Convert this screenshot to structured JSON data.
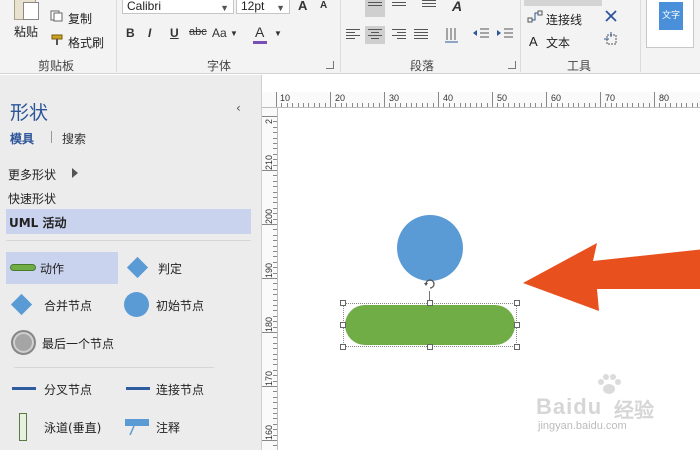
{
  "ribbon": {
    "clipboard": {
      "paste": "粘贴",
      "copy": "复制",
      "format_painter": "格式刷",
      "group": "剪贴板"
    },
    "font": {
      "name": "Calibri",
      "size": "12pt",
      "grow": "A",
      "shrink": "A",
      "bold": "B",
      "italic": "I",
      "underline": "U",
      "strike": "abc",
      "case": "Aa",
      "color_letter": "A",
      "group": "字体"
    },
    "paragraph": {
      "group": "段落",
      "text_glyph": "A"
    },
    "tools": {
      "connector": "连接线",
      "text": "文本",
      "text_letter": "A",
      "group": "工具"
    },
    "text_style": {
      "label": "文字"
    }
  },
  "shapes_pane": {
    "title": "形状",
    "collapse": "‹",
    "tabs": {
      "models": "模具",
      "search": "搜索"
    },
    "more_shapes": "更多形状",
    "quick_shapes": "快速形状",
    "stencil_title": "UML 活动",
    "stencils": {
      "action": "动作",
      "decision": "判定",
      "merge": "合并节点",
      "initial": "初始节点",
      "final": "最后一个节点",
      "fork": "分叉节点",
      "join": "连接节点",
      "swimlane": "泳道(垂直)",
      "note": "注释"
    }
  },
  "ruler": {
    "h_ticks": [
      "10",
      "20",
      "30",
      "40",
      "50",
      "60",
      "70",
      "80"
    ],
    "v_ticks": [
      "210",
      "200",
      "190",
      "180",
      "170",
      "160",
      "2"
    ]
  },
  "colors": {
    "accent": "#2d5599",
    "initial_node": "#5b9bd5",
    "action_node": "#70ad47",
    "arrow": "#e8501d",
    "selected_row": "#c9d3ed"
  },
  "watermark": {
    "brand": "Bai",
    "du": "du",
    "cn": "经验",
    "url": "jingyan.baidu.com"
  }
}
